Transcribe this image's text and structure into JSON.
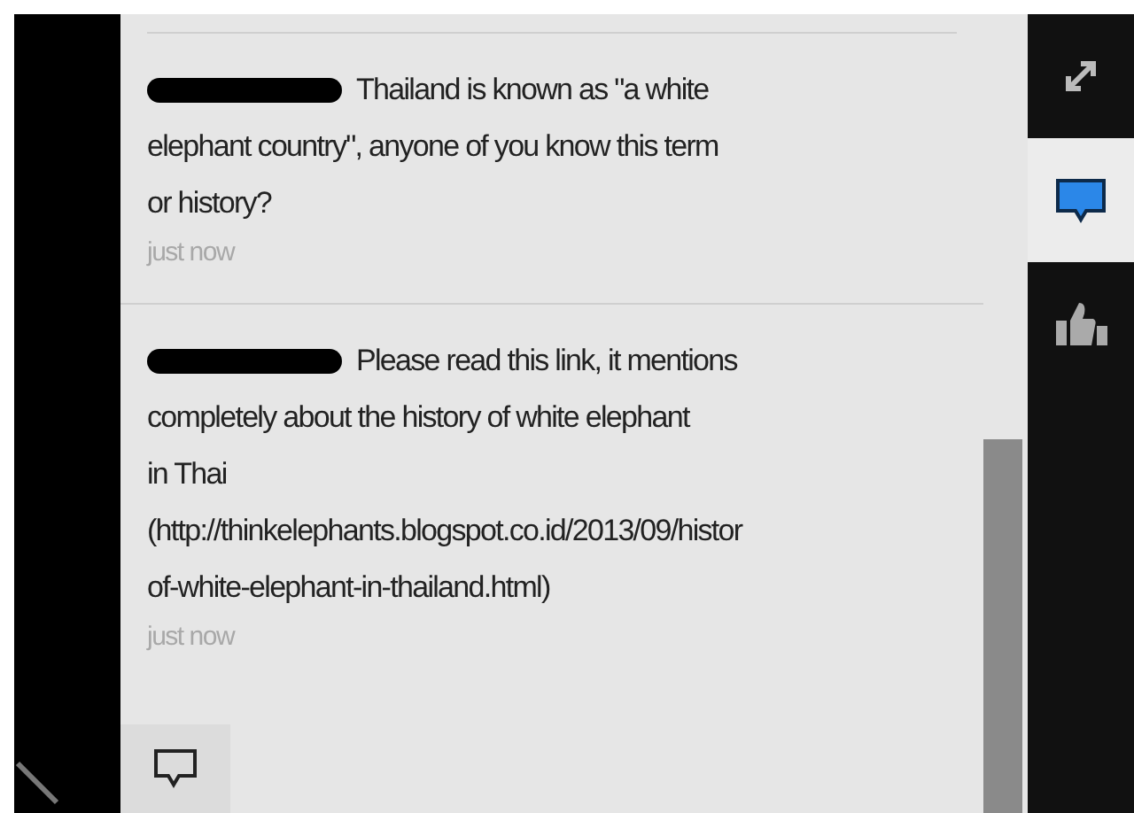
{
  "messages": [
    {
      "redacted_name": true,
      "lines": [
        "Thailand is known as \"a white",
        "elephant country\", anyone of you know this term",
        "or history?"
      ],
      "time": "just now"
    },
    {
      "redacted_name": true,
      "lines": [
        "Please read this link, it mentions",
        "completely about the history of white elephant",
        "in Thai",
        "(http://thinkelephants.blogspot.co.id/2013/09/histor",
        "of-white-elephant-in-thailand.html)"
      ],
      "time": "just now"
    }
  ],
  "side_tabs": [
    {
      "kind": "expand",
      "selected": false
    },
    {
      "kind": "comments",
      "selected": true
    },
    {
      "kind": "like",
      "selected": false
    }
  ]
}
